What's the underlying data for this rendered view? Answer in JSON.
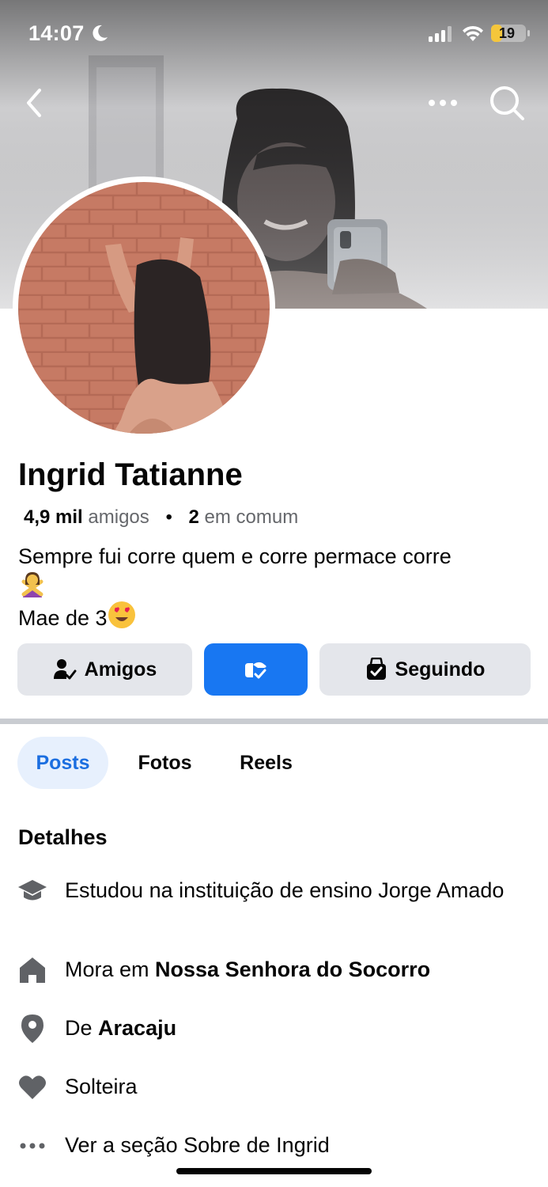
{
  "status_bar": {
    "time": "14:07",
    "battery": "19",
    "battery_level": 0.19
  },
  "nav": {
    "back_icon": "chevron-left-icon",
    "more_icon": "more-horizontal-icon",
    "search_icon": "search-icon"
  },
  "profile": {
    "name": "Ingrid Tatianne",
    "friends_count": "4,9 mil",
    "friends_label": "amigos",
    "separator": "•",
    "mutual_count": "2",
    "mutual_label": "em comum",
    "bio_line1": "Sempre fui corre quem e corre permace corre",
    "bio_line1_emoji": "🙅‍♀️",
    "bio_line2": "Mae de 3",
    "bio_line2_emoji": "😍"
  },
  "actions": {
    "friends_label": "Amigos",
    "friends_icon": "friend-check-icon",
    "messenger_icon": "messenger-icon",
    "following_label": "Seguindo",
    "following_icon": "following-icon"
  },
  "tabs": [
    {
      "label": "Posts",
      "active": true
    },
    {
      "label": "Fotos",
      "active": false
    },
    {
      "label": "Reels",
      "active": false
    }
  ],
  "details": {
    "title": "Detalhes",
    "items": [
      {
        "icon": "graduation-cap-icon",
        "prefix": "Estudou na instituição de ensino Jorge Amado",
        "bold": ""
      },
      {
        "icon": "home-icon",
        "prefix": "Mora em ",
        "bold": "Nossa Senhora do Socorro"
      },
      {
        "icon": "location-pin-icon",
        "prefix": "De ",
        "bold": "Aracaju"
      },
      {
        "icon": "heart-icon",
        "prefix": "Solteira",
        "bold": ""
      },
      {
        "icon": "more-horizontal-icon",
        "prefix": "Ver a seção Sobre de Ingrid",
        "bold": ""
      }
    ]
  },
  "colors": {
    "primary_blue": "#1877f2",
    "button_gray": "#e4e6eb",
    "active_tab_bg": "#e7f0fd",
    "active_tab_text": "#1b6ee0",
    "secondary_text": "#65676b"
  }
}
